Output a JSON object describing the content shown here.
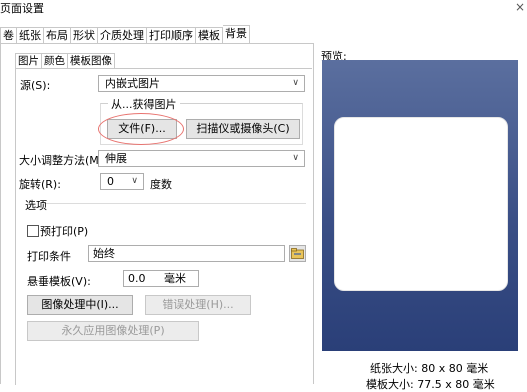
{
  "window": {
    "title": "页面设置",
    "close": "×"
  },
  "main_tabs": [
    "卷",
    "纸张",
    "布局",
    "形状",
    "介质处理",
    "打印顺序",
    "模板",
    "背景"
  ],
  "sub_tabs": [
    "图片",
    "颜色",
    "模板图像"
  ],
  "source": {
    "label": "源(S):",
    "value": "内嵌式图片"
  },
  "obtain_group": {
    "title": "从...获得图片",
    "file_button": "文件(F)...",
    "scanner_button": "扫描仪或摄像头(C)"
  },
  "resize": {
    "label": "大小调整方法(M):",
    "value": "伸展"
  },
  "rotate": {
    "label": "旋转(R):",
    "value": "0",
    "unit": "度数"
  },
  "options": {
    "title": "选项",
    "preprint_label": "预打印(P)",
    "preprint_checked": false,
    "print_condition_label": "打印条件",
    "print_condition_value": "始终",
    "hang_label": "悬垂模板(V):",
    "hang_value": "0.0",
    "hang_unit": "毫米",
    "image_processing_button": "图像处理中(I)...",
    "error_handling_button": "错误处理(H)...",
    "permanent_button": "永久应用图像处理(P)"
  },
  "preview": {
    "label": "预览:",
    "paper_size": "纸张大小:  80 x 80 毫米",
    "template_size": "模板大小:  77.5 x 80 毫米"
  },
  "colors": {
    "highlight_ring": "#e8736f",
    "preview_bg": "#3a4f86"
  },
  "icons": {
    "caret": "chevron-down-icon",
    "folder": "folder-icon"
  }
}
